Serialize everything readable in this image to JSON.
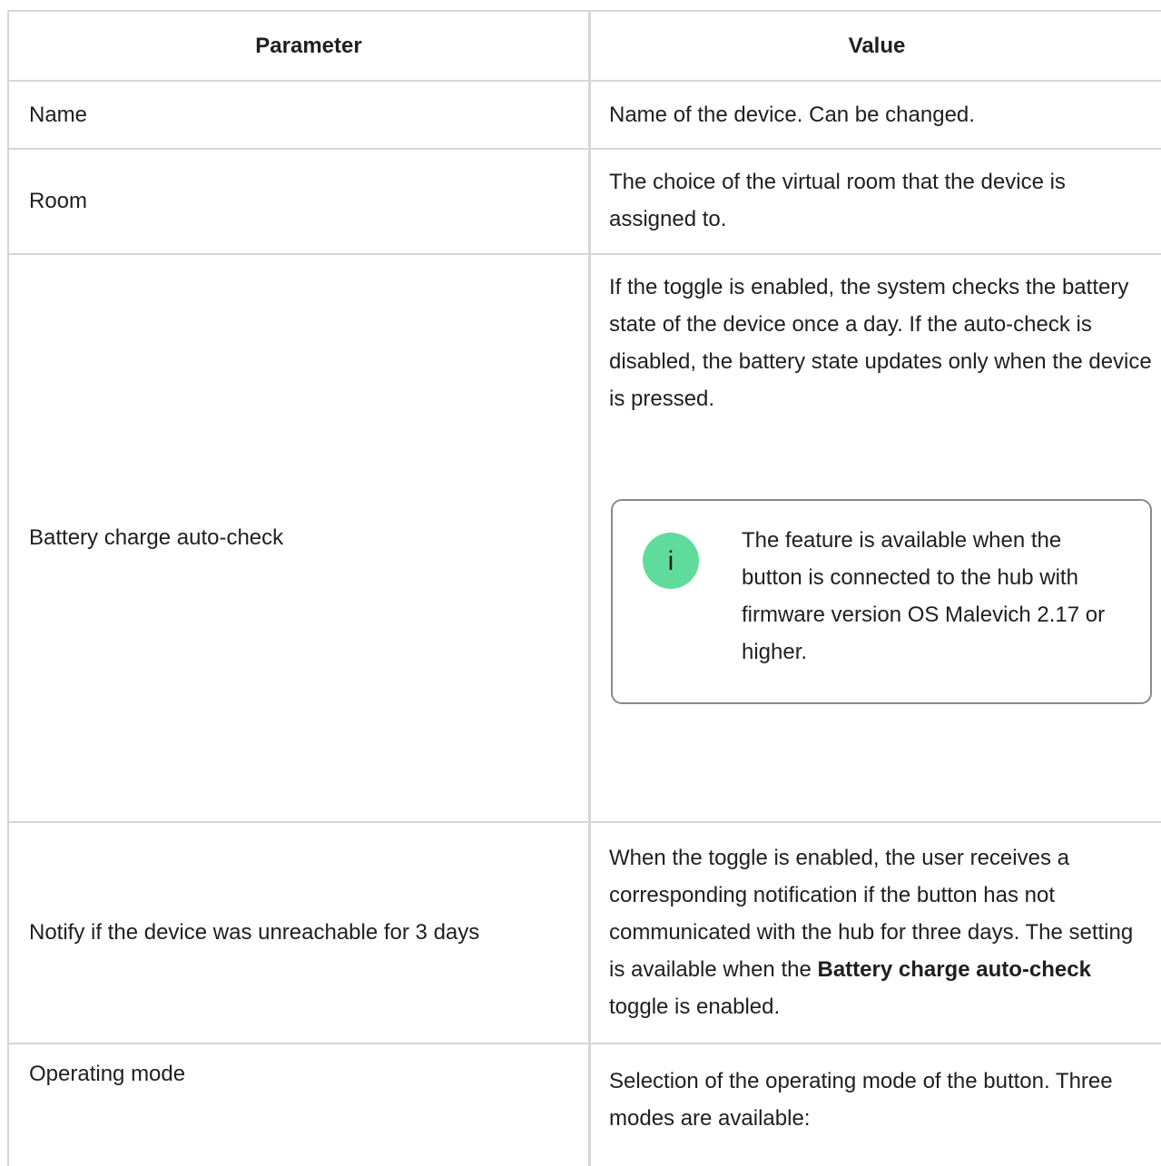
{
  "table": {
    "headers": {
      "parameter": "Parameter",
      "value": "Value"
    },
    "rows": [
      {
        "parameter": "Name",
        "value": "Name of the device. Can be changed."
      },
      {
        "parameter": "Room",
        "value": "The choice of the virtual room that the device is assigned to."
      },
      {
        "parameter": "Battery charge auto-check",
        "value": "If the toggle is enabled, the system checks the battery state of the device once a day. If the auto-check is disabled, the battery state updates only when the device is pressed.",
        "note": {
          "icon": "info-icon",
          "icon_glyph": "i",
          "icon_color": "#5fdc9c",
          "text": "The feature is available when the button is connected to the hub with firmware version OS Malevich 2.17 or higher."
        }
      },
      {
        "parameter": "Notify if the device was unreachable for 3 days",
        "value_before": "When the toggle is enabled, the user receives a corresponding notification if the button has not communicated with the hub for three days. The setting is available when the ",
        "value_bold": "Battery charge auto-check",
        "value_after": " toggle is enabled."
      },
      {
        "parameter": "Operating mode",
        "value": "Selection of the operating mode of the button. Three modes are available:"
      }
    ]
  }
}
